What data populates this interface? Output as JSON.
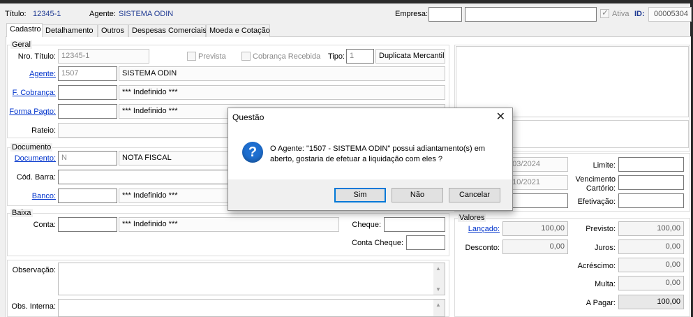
{
  "header": {
    "titulo_label": "Título:",
    "titulo_value": "12345-1",
    "agente_label": "Agente:",
    "agente_value": "SISTEMA ODIN",
    "empresa_label": "Empresa:",
    "empresa_code": "",
    "empresa_name": "",
    "ativa_label": "Ativa",
    "id_label": "ID:",
    "id_value": "00005304"
  },
  "tabs": [
    {
      "label": "Cadastro",
      "active": true
    },
    {
      "label": "Detalhamento"
    },
    {
      "label": "Outros"
    },
    {
      "label": "Despesas Comerciais"
    },
    {
      "label": "Moeda e Cotação"
    }
  ],
  "geral": {
    "title": "Geral",
    "nro_titulo_label": "Nro. Título:",
    "nro_titulo_value": "12345-1",
    "prevista_label": "Prevista",
    "cobranca_recebida_label": "Cobrança Recebida",
    "tipo_label": "Tipo:",
    "tipo_code": "1",
    "tipo_name": "Duplicata Mercantil",
    "agente_label": "Agente:",
    "agente_code": "1507",
    "agente_name": "SISTEMA ODIN",
    "f_cobranca_label": "F. Cobrança:",
    "f_cobranca_code": "",
    "f_cobranca_name": "*** Indefinido ***",
    "forma_pagto_label": "Forma Pagto:",
    "forma_pagto_code": "",
    "forma_pagto_name": "*** Indefinido ***",
    "rateio_label": "Rateio:"
  },
  "documento": {
    "title": "Documento",
    "documento_label": "Documento:",
    "documento_code": "N",
    "documento_name": "NOTA FISCAL",
    "cod_barra_label": "Cód. Barra:",
    "banco_label": "Banco:",
    "banco_code": "",
    "banco_name": "*** Indefinido ***"
  },
  "baixa": {
    "title": "Baixa",
    "conta_label": "Conta:",
    "conta_code": "",
    "conta_name": "*** Indefinido ***",
    "cheque_label": "Cheque:",
    "conta_cheque_label": "Conta Cheque:"
  },
  "observacao_label": "Observação:",
  "obs_interna_label": "Obs. Interna:",
  "datas": {
    "date1": "4/03/2024",
    "date2": "5/10/2021",
    "limite_label": "Limite:",
    "vencimento_cartorio_label_1": "Vencimento",
    "vencimento_cartorio_label_2": "Cartório:",
    "efetivacao_label": "Efetivação:"
  },
  "valores": {
    "title": "Valores",
    "lancado_label": "Lançado:",
    "lancado_value": "100,00",
    "previsto_label": "Previsto:",
    "previsto_value": "100,00",
    "desconto_label": "Desconto:",
    "desconto_value": "0,00",
    "juros_label": "Juros:",
    "juros_value": "0,00",
    "acrescimo_label": "Acréscimo:",
    "acrescimo_value": "0,00",
    "multa_label": "Multa:",
    "multa_value": "0,00",
    "a_pagar_label": "A Pagar:",
    "a_pagar_value": "100,00"
  },
  "dialog": {
    "title": "Questão",
    "message": "O Agente: \"1507 - SISTEMA ODIN\" possui adiantamento(s) em aberto, gostaria de efetuar a liquidação com eles ?",
    "btn_sim": "Sim",
    "btn_nao": "Não",
    "btn_cancelar": "Cancelar",
    "icon": "question-icon",
    "accent": "#1e6fd0"
  }
}
